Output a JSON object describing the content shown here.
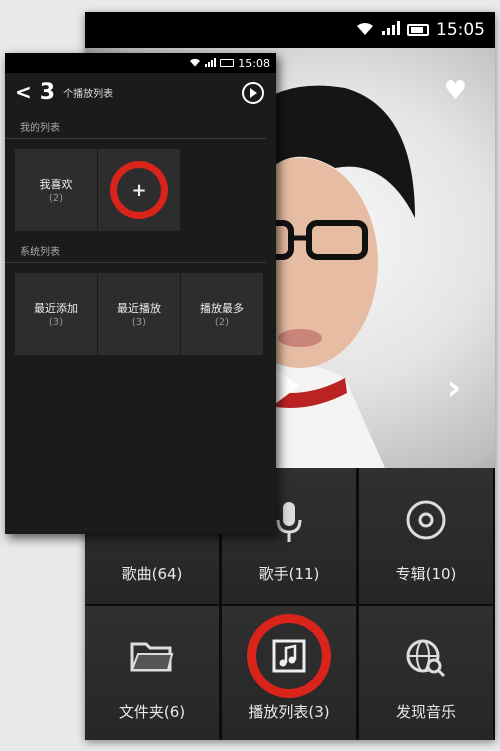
{
  "back_screen": {
    "status_time": "15:05",
    "tiles": [
      {
        "label": "歌曲(64)",
        "icon": "music-note-icon"
      },
      {
        "label": "歌手(11)",
        "icon": "microphone-icon"
      },
      {
        "label": "专辑(10)",
        "icon": "disc-icon"
      },
      {
        "label": "文件夹(6)",
        "icon": "folder-icon"
      },
      {
        "label": "播放列表(3)",
        "icon": "playlist-icon"
      },
      {
        "label": "发现音乐",
        "icon": "globe-search-icon"
      }
    ]
  },
  "front_screen": {
    "status_time": "15:08",
    "header": {
      "count": "3",
      "title": "个播放列表"
    },
    "my_lists": {
      "section": "我的列表",
      "items": [
        {
          "name": "我喜欢",
          "count": "(2)"
        },
        {
          "name": "新建列表",
          "icon": "plus-icon"
        }
      ]
    },
    "system_lists": {
      "section": "系统列表",
      "items": [
        {
          "name": "最近添加",
          "count": "(3)"
        },
        {
          "name": "最近播放",
          "count": "(3)"
        },
        {
          "name": "播放最多",
          "count": "(2)"
        }
      ]
    }
  },
  "colors": {
    "highlight": "#d8241b",
    "tile_bg": "#2b2b2b",
    "panel_bg": "#1b1b1b"
  }
}
